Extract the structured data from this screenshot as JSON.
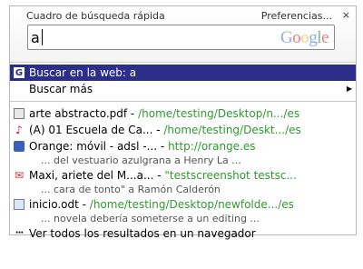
{
  "header": {
    "title": "Cuadro de búsqueda rápida",
    "preferences": "Preferencias...",
    "close": "×"
  },
  "search": {
    "value": "a",
    "logo": "Google"
  },
  "results": {
    "web_search": {
      "icon": "google-icon",
      "label": "Buscar en la web: a"
    },
    "search_more": {
      "label": "Buscar más",
      "arrow": "▶"
    },
    "items": [
      {
        "icon": "document-icon",
        "title": "arte abstracto.pdf - ",
        "path": "/home/testing/Desktop/n.../es",
        "sub": ""
      },
      {
        "icon": "music-note-icon",
        "title": "(A) 01 Escuela de Ca... - ",
        "path": "/home/testing/Deskt.../es",
        "sub": ""
      },
      {
        "icon": "web-page-icon",
        "title": "Orange: móvil - adsl -... - ",
        "path": "http://orange.es",
        "sub": "... del vestuario azulgrana a Henry La ..."
      },
      {
        "icon": "mail-icon",
        "title": "Maxi, ariete del M...a... - ",
        "path": "\"testscreenshot testsc...",
        "sub": "... cara de tonto\" a Ramón Calderón"
      },
      {
        "icon": "odt-document-icon",
        "title": "inicio.odt - ",
        "path": "/home/testing/Desktop/newfolde.../es",
        "sub": "... novela debería someterse a un editing ..."
      }
    ],
    "view_all": {
      "icon": "ellipsis-icon",
      "label": "Ver todos los resultados en un navegador"
    }
  },
  "colors": {
    "selection": "#2b2f8a",
    "path": "#2e9a2e"
  }
}
